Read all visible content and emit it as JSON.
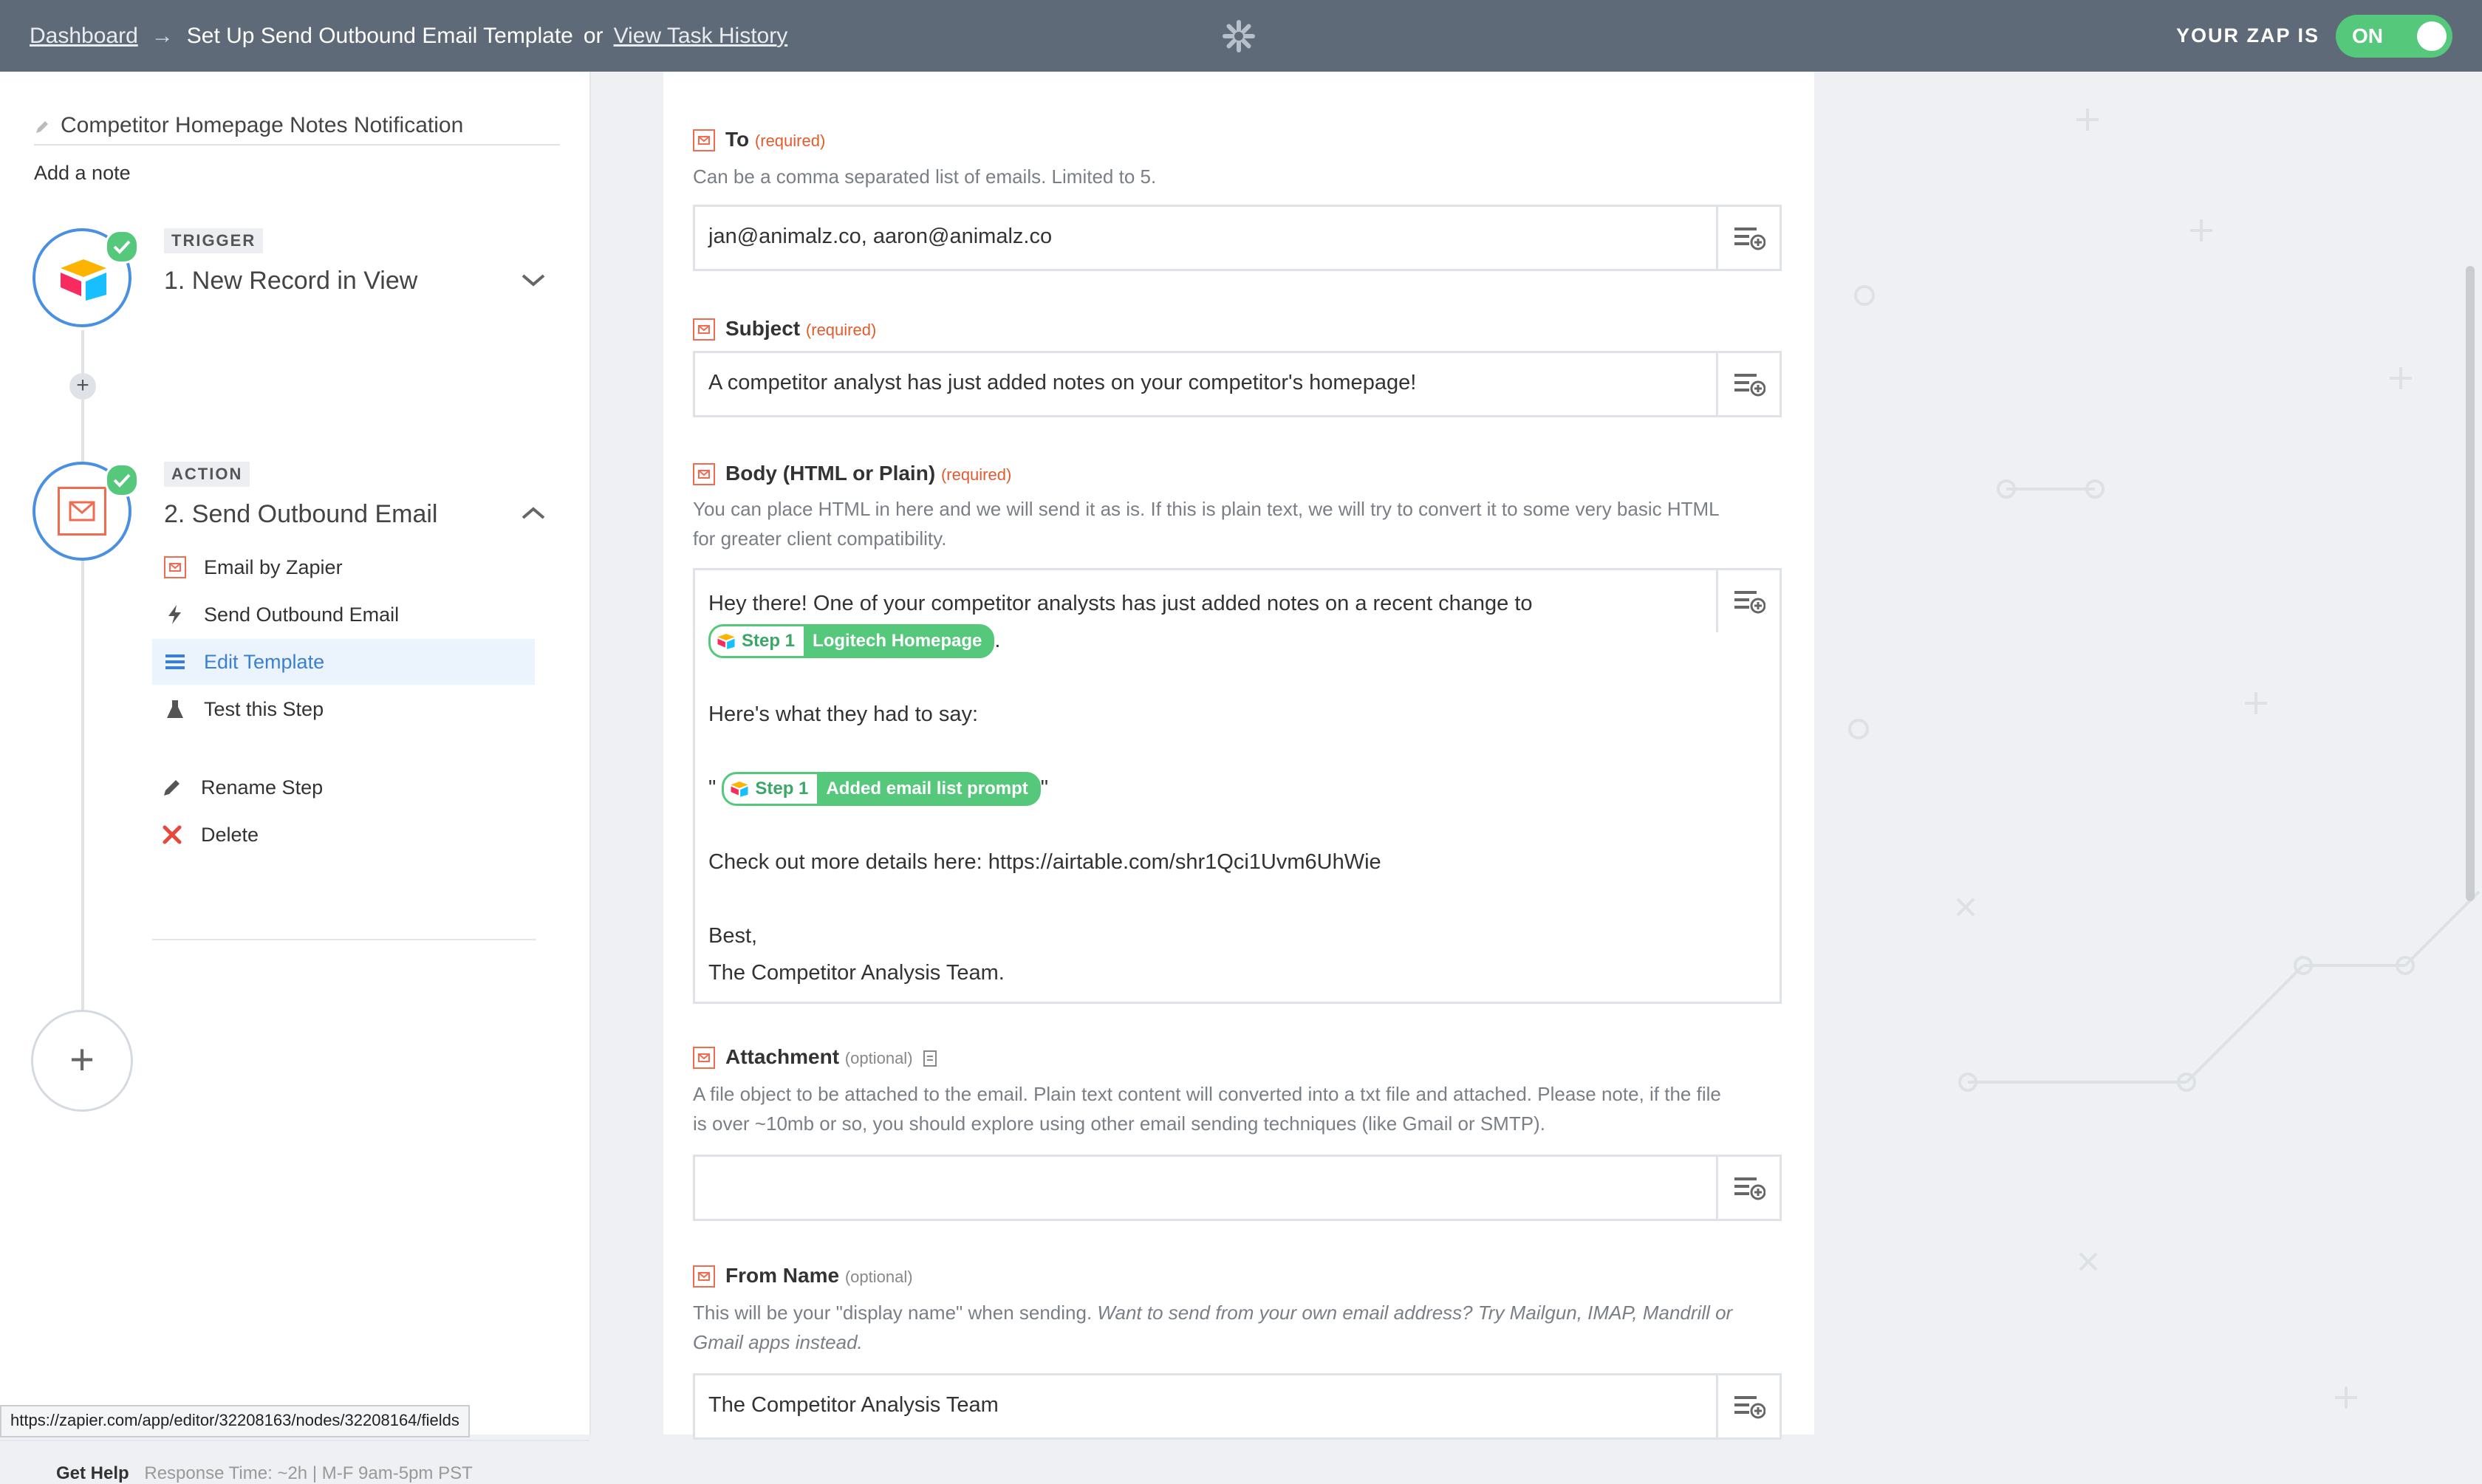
{
  "topbar": {
    "breadcrumb_dashboard": "Dashboard",
    "breadcrumb_arrow": "→",
    "current_page": "Set Up Send Outbound Email Template",
    "or_text": "or",
    "task_history_link": "View Task History",
    "zap_status_label": "YOUR ZAP IS",
    "toggle_label": "ON"
  },
  "sidebar": {
    "zap_name": "Competitor Homepage Notes Notification",
    "add_note": "Add a note",
    "trigger": {
      "badge": "TRIGGER",
      "title": "1. New Record in View",
      "icon": "airtable-logo"
    },
    "action": {
      "badge": "ACTION",
      "title": "2. Send Outbound Email",
      "icon": "mail-icon"
    },
    "menu": [
      {
        "label": "Email by Zapier",
        "icon": "mail-icon"
      },
      {
        "label": "Send Outbound Email",
        "icon": "bolt-icon"
      },
      {
        "label": "Edit Template",
        "icon": "list-icon",
        "active": true
      },
      {
        "label": "Test this Step",
        "icon": "flask-icon"
      },
      {
        "label": "Rename Step",
        "icon": "pencil-icon"
      },
      {
        "label": "Delete",
        "icon": "x-icon"
      }
    ],
    "help": {
      "title": "Get Help",
      "details": "Response Time: ~2h | M-F 9am-5pm PST"
    }
  },
  "status_url": "https://zapier.com/app/editor/32208163/nodes/32208164/fields",
  "form": {
    "to": {
      "label": "To",
      "tag": "(required)",
      "help": "Can be a comma separated list of emails. Limited to 5.",
      "value": "jan@animalz.co, aaron@animalz.co"
    },
    "subject": {
      "label": "Subject",
      "tag": "(required)",
      "value": "A competitor analyst has just added notes on your competitor's homepage!"
    },
    "body": {
      "label": "Body (HTML or Plain)",
      "tag": "(required)",
      "help_line1": "You can place HTML in here and we will send it as is. If this is plain text, we will try to convert it to some very basic HTML",
      "help_line2": "for greater client compatibility.",
      "line1": "Hey there! One of your competitor analysts has just added notes on a recent change to",
      "pill1_step": "Step 1",
      "pill1_value": "Logitech Homepage",
      "pill1_after": ".",
      "line2": "Here's what they had to say:",
      "quote_open": "\"",
      "pill2_step": "Step 1",
      "pill2_value": "Added email list prompt",
      "quote_close": "\"",
      "line3": "Check out more details here: https://airtable.com/shr1Qci1Uvm6UhWie",
      "line4": "Best,",
      "line5": "The Competitor Analysis Team."
    },
    "attachment": {
      "label": "Attachment",
      "tag": "(optional)",
      "help_line1": "A file object to be attached to the email. Plain text content will converted into a txt file and attached. Please note, if the file",
      "help_line2": "is over ~10mb or so, you should explore using other email sending techniques (like Gmail or SMTP).",
      "value": ""
    },
    "from_name": {
      "label": "From Name",
      "tag": "(optional)",
      "help_line1_plain": "This will be your \"display name\" when sending.",
      "help_line1_italic": "Want to send from your own email address? Try Mailgun, IMAP, Mandrill or",
      "help_line2_italic": "Gmail apps instead.",
      "value": "The Competitor Analysis Team"
    }
  },
  "colors": {
    "topbar": "#5e6a78",
    "toggle_on": "#55c87c",
    "accent_blue": "#4a90e2",
    "required": "#e25b2d",
    "pill_green": "#55c87c",
    "mail_orange": "#f26b4f",
    "delete_red": "#e8483b"
  }
}
